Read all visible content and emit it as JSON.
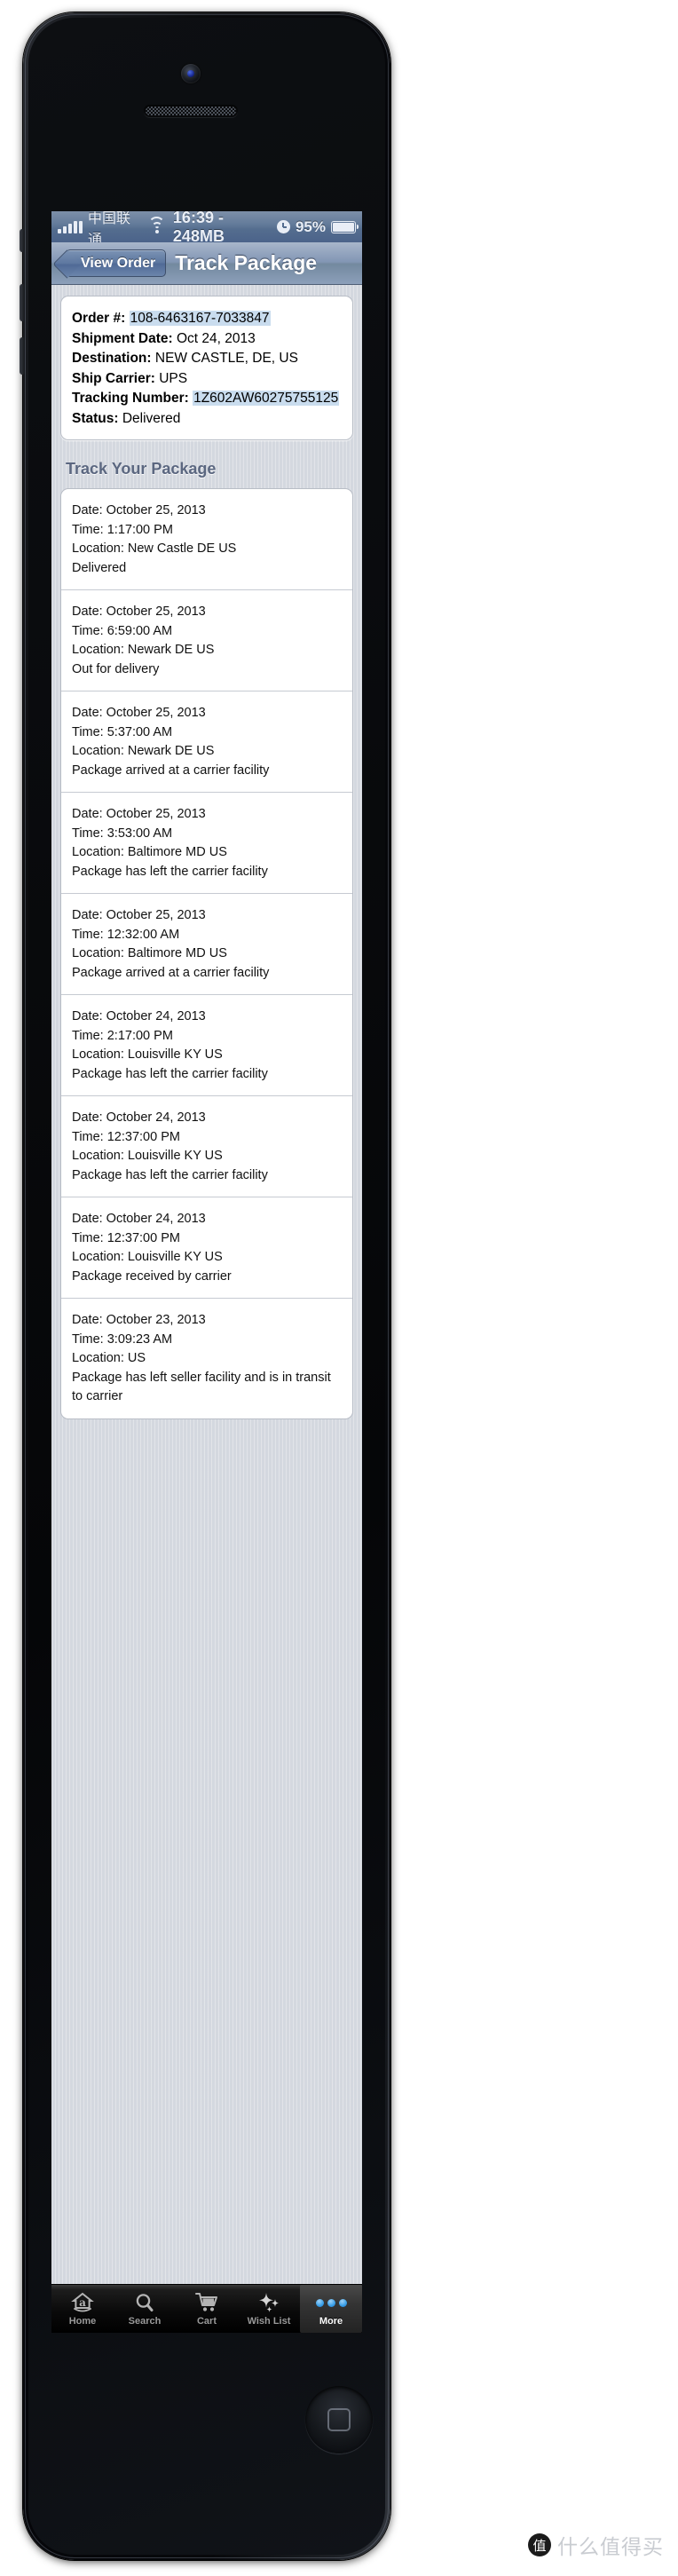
{
  "status_bar": {
    "carrier": "中国联通",
    "signal_icon": "signal-bars-icon",
    "wifi_icon": "wifi-icon",
    "time_and_data": "16:39 - 248MB",
    "alarm_icon": "clock-icon",
    "battery_percent": "95%",
    "battery_icon": "battery-icon"
  },
  "nav_bar": {
    "back_label": "View Order",
    "title": "Track Package"
  },
  "order_card": {
    "rows": [
      {
        "label": "Order #:",
        "value": "108-6463167-7033847",
        "highlighted": true
      },
      {
        "label": "Shipment Date:",
        "value": "Oct 24, 2013",
        "highlighted": false
      },
      {
        "label": "Destination:",
        "value": "NEW CASTLE, DE, US",
        "highlighted": false
      },
      {
        "label": "Ship Carrier:",
        "value": "UPS",
        "highlighted": false
      },
      {
        "label": "Tracking Number:",
        "value": "1Z602AW60275755125",
        "highlighted": true
      },
      {
        "label": "Status:",
        "value": "Delivered",
        "highlighted": false
      }
    ]
  },
  "section": {
    "title": "Track Your Package"
  },
  "tracking_events": [
    {
      "date": "Date: October 25, 2013",
      "time": "Time: 1:17:00 PM",
      "location": "Location: New Castle DE US",
      "description": "Delivered"
    },
    {
      "date": "Date: October 25, 2013",
      "time": "Time: 6:59:00 AM",
      "location": "Location: Newark DE US",
      "description": "Out for delivery"
    },
    {
      "date": "Date: October 25, 2013",
      "time": "Time: 5:37:00 AM",
      "location": "Location: Newark DE US",
      "description": "Package arrived at a carrier facility"
    },
    {
      "date": "Date: October 25, 2013",
      "time": "Time: 3:53:00 AM",
      "location": "Location: Baltimore MD US",
      "description": "Package has left the carrier facility"
    },
    {
      "date": "Date: October 25, 2013",
      "time": "Time: 12:32:00 AM",
      "location": "Location: Baltimore MD US",
      "description": "Package arrived at a carrier facility"
    },
    {
      "date": "Date: October 24, 2013",
      "time": "Time: 2:17:00 PM",
      "location": "Location: Louisville KY US",
      "description": "Package has left the carrier facility"
    },
    {
      "date": "Date: October 24, 2013",
      "time": "Time: 12:37:00 PM",
      "location": "Location: Louisville KY US",
      "description": "Package has left the carrier facility"
    },
    {
      "date": "Date: October 24, 2013",
      "time": "Time: 12:37:00 PM",
      "location": "Location: Louisville KY US",
      "description": "Package received by carrier"
    },
    {
      "date": "Date: October 23, 2013",
      "time": "Time: 3:09:23 AM",
      "location": "Location: US",
      "description": "Package has left seller facility and is in transit to carrier"
    }
  ],
  "tab_bar": {
    "tabs": [
      {
        "label": "Home",
        "icon": "amazon-home-icon",
        "selected": false
      },
      {
        "label": "Search",
        "icon": "search-icon",
        "selected": false
      },
      {
        "label": "Cart",
        "icon": "cart-icon",
        "selected": false
      },
      {
        "label": "Wish List",
        "icon": "sparkle-star-icon",
        "selected": false
      },
      {
        "label": "More",
        "icon": "three-dots-icon",
        "selected": true
      }
    ]
  },
  "watermark": {
    "badge": "值",
    "text": "什么值得买"
  },
  "colors": {
    "statusbar": "#5d7597",
    "navbar": "#8296b4",
    "highlight": "#c9dcee",
    "section_title": "#5b6780",
    "tab_selected_dot": "#3fa2e8"
  }
}
